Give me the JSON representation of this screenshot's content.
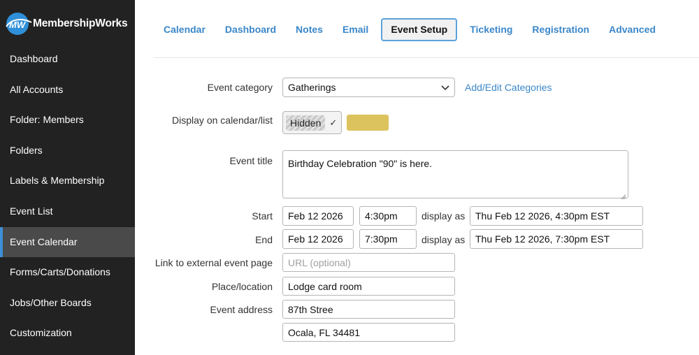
{
  "app": {
    "logo_text": "MembershipWorks",
    "logo_mark": "MW"
  },
  "sidebar": {
    "items": [
      {
        "label": "Dashboard"
      },
      {
        "label": "All Accounts"
      },
      {
        "label": "Folder: Members"
      },
      {
        "label": "Folders"
      },
      {
        "label": "Labels & Membership"
      },
      {
        "label": "Event List"
      },
      {
        "label": "Event Calendar",
        "active": true
      },
      {
        "label": "Forms/Carts/Donations"
      },
      {
        "label": "Jobs/Other Boards"
      },
      {
        "label": "Customization"
      }
    ]
  },
  "tabs": [
    {
      "label": "Calendar"
    },
    {
      "label": "Dashboard"
    },
    {
      "label": "Notes"
    },
    {
      "label": "Email"
    },
    {
      "label": "Event Setup",
      "active": true
    },
    {
      "label": "Ticketing"
    },
    {
      "label": "Registration"
    },
    {
      "label": "Advanced"
    }
  ],
  "form": {
    "category": {
      "label": "Event category",
      "value": "Gatherings",
      "link": "Add/Edit Categories"
    },
    "display": {
      "label": "Display on calendar/list",
      "value": "Hidden",
      "color": "#dcc35e"
    },
    "title": {
      "label": "Event title",
      "value": "Birthday Celebration \"90\" is here."
    },
    "start": {
      "label": "Start",
      "date": "Feb 12 2026",
      "time": "4:30pm",
      "display_as": "display as",
      "display_value": "Thu Feb 12 2026, 4:30pm EST"
    },
    "end": {
      "label": "End",
      "date": "Feb 12 2026",
      "time": "7:30pm",
      "display_as": "display as",
      "display_value": "Thu Feb 12 2026, 7:30pm EST"
    },
    "external_link": {
      "label": "Link to external event page",
      "placeholder": "URL (optional)"
    },
    "place": {
      "label": "Place/location",
      "value": "Lodge card room"
    },
    "address": {
      "label": "Event address",
      "line1": "87th Stree",
      "line2": "Ocala, FL 34481"
    }
  },
  "colors": {
    "accent": "#3a87c9",
    "sidebar_bg": "#222222",
    "active_nav_bg": "#4a4a4a",
    "active_indicator": "#3d8fd6"
  }
}
